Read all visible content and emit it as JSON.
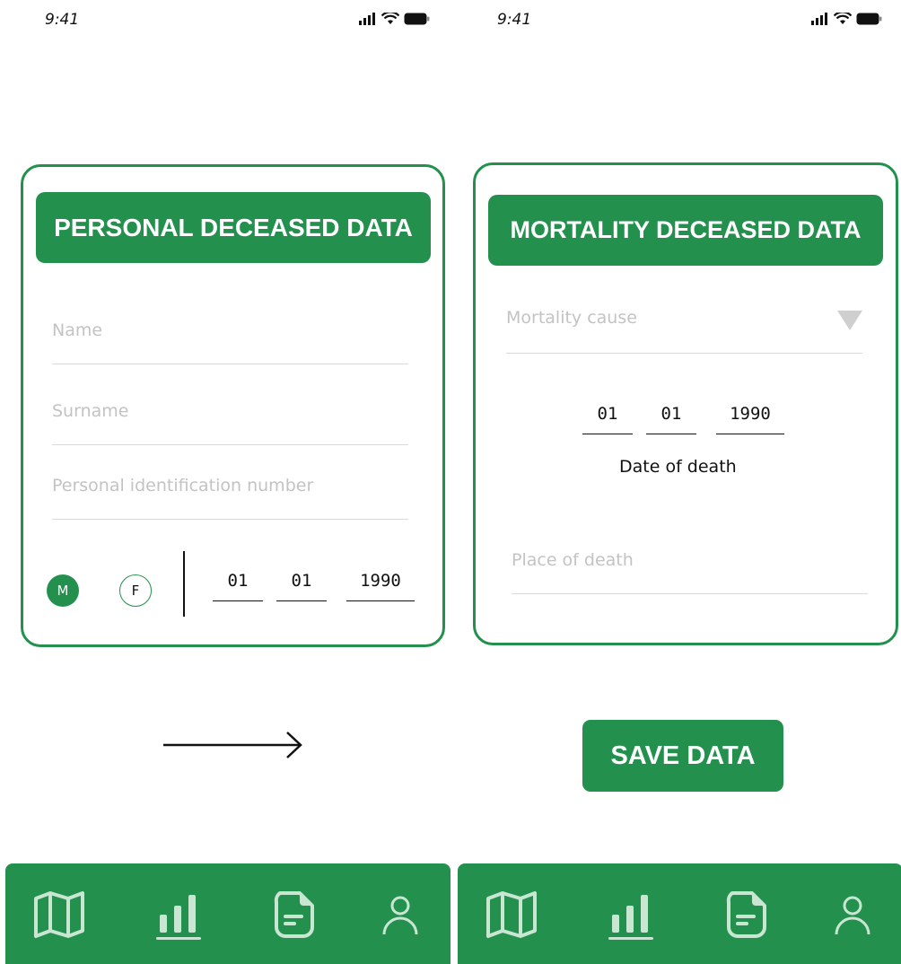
{
  "status_bar": {
    "time": "9:41"
  },
  "personal_screen": {
    "title": "PERSONAL DECEASED DATA",
    "name_placeholder": "Name",
    "surname_placeholder": "Surname",
    "pin_placeholder": "Personal identification number",
    "sex_male": "M",
    "sex_female": "F",
    "sex_selected": "M",
    "birth_day": "01",
    "birth_month": "01",
    "birth_year": "1990"
  },
  "mortality_screen": {
    "title": "MORTALITY DECEASED DATA",
    "cause_placeholder": "Mortality cause",
    "death_day": "01",
    "death_month": "01",
    "death_year": "1990",
    "date_caption": "Date of death",
    "place_placeholder": "Place of death",
    "save_label": "SAVE DATA"
  },
  "nav": {
    "items": [
      {
        "icon": "map-icon"
      },
      {
        "icon": "bar-chart-icon"
      },
      {
        "icon": "document-icon"
      },
      {
        "icon": "user-icon"
      }
    ]
  },
  "colors": {
    "primary": "#23914d",
    "icon": "#c8e6d2",
    "placeholder": "#c3c3c3"
  }
}
